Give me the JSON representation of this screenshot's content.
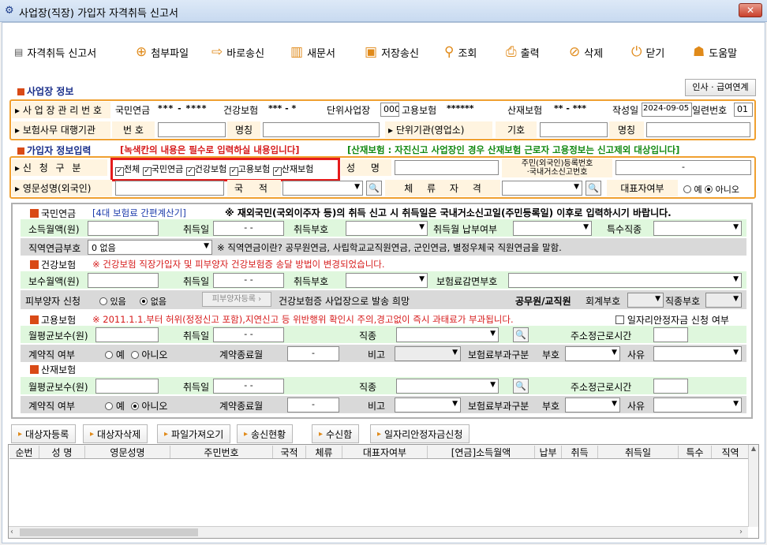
{
  "window": {
    "title": "사업장(직장) 가입자 자격취득 신고서",
    "close": "✕"
  },
  "toolbar": {
    "form_title": "자격취득 신고서",
    "attach": "첨부파일",
    "send_now": "바로송신",
    "new_doc": "새문서",
    "save_send": "저장송신",
    "query": "조회",
    "print": "출력",
    "delete": "삭제",
    "close": "닫기",
    "help": "도움말"
  },
  "workplace": {
    "section": "사업장 정보",
    "link_button": "인사 · 급여연계",
    "mgmt_no_label": "사 업 장 관 리 번 호",
    "pension_label": "국민연금",
    "pension_value": "*** - ****",
    "health_label": "건강보험",
    "health_value": "*** - *",
    "unit_label": "단위사업장",
    "unit_value": "000",
    "employ_label": "고용보험",
    "employ_value": "******",
    "industrial_label": "산재보험",
    "industrial_value": "** - ***",
    "written_label": "작성일",
    "written_value": "2024-09-05",
    "serial_label": "일련번호",
    "serial_value": "01",
    "agency_label": "보험사무 대행기관",
    "no_label": "번 호",
    "name_label": "명칭",
    "unit_org_label": "단위기관(영업소)",
    "code_label": "기호",
    "name2_label": "명칭"
  },
  "subscriber": {
    "section": "가입자 정보입력",
    "required_note": "[녹색칸의 내용은 필수로 입력하실 내용입니다]",
    "industrial_note": "[산재보험 : 자진신고 사업장인 경우 산재보험 근로자 고용정보는 신고제외 대상입니다]",
    "apply_label": "신 청 구 분",
    "apply_all": "전체",
    "apply_pension": "국민연금",
    "apply_health": "건강보험",
    "apply_employ": "고용보험",
    "apply_industrial": "산재보험",
    "name_label": "성 명",
    "resident_label_1": "주민(외국인)등록번호",
    "resident_label_2": "·국내거소신고번호",
    "resident_value": "-",
    "eng_name_label": "영문성명(외국인)",
    "nation_label": "국 적",
    "stay_label": "체 류 자 격",
    "rep_label": "대표자여부",
    "yes": "예",
    "no": "아니오"
  },
  "pension": {
    "title": "국민연금",
    "calc_link": "[4대 보험료 간편계산기]",
    "notice": "※ 재외국민(국외이주자 등)의 취득 신고 시 취득일은 국내거소신고일(주민등록일) 이후로 입력하시기 바랍니다.",
    "income_label": "소득월액(원)",
    "acq_date_label": "취득일",
    "acq_date_value": "- -",
    "acq_code_label": "취득부호",
    "pay_label": "취득월 납부여부",
    "special_label": "특수직종",
    "occ_pension_label": "직역연금부호",
    "occ_pension_value": "0    없음",
    "occ_note": "※ 직역연금이란? 공무원연금, 사립학교교직원연금, 군인연금, 별정우체국 직원연금을 말함."
  },
  "health": {
    "title": "건강보험",
    "notice": "※ 건강보험 직장가입자 및 피부양자 건강보험증 송달 방법이 변경되었습니다.",
    "pay_label": "보수월액(원)",
    "acq_date_label": "취득일",
    "acq_date_value": "- -",
    "acq_code_label": "취득부호",
    "reduce_label": "보험료감면부호",
    "dependent_label": "피부양자 신청",
    "has": "있음",
    "none": "없음",
    "dep_button": "피부양자등록 ›",
    "card_note": "건강보험증 사업장으로 발송 희망",
    "civil_label": "공무원/교직원",
    "account_label": "회계부호",
    "job_label": "직종부호"
  },
  "employ": {
    "title": "고용보험",
    "notice": "※ 2011.1.1.부터 허위(정정신고 포함),지연신고 등 위반행위 확인시 주의,경고없이 즉시 과태료가 부과됩니다.",
    "stability_label": "일자리안정자금 신청 여부",
    "avg_pay_label": "월평균보수(원)",
    "acq_date_label": "취득일",
    "acq_date_value": "- -",
    "job_label": "직종",
    "hours_label": "주소정근로시간",
    "contract_label": "계약직 여부",
    "yes": "예",
    "no": "아니오",
    "end_label": "계약종료월",
    "end_value": "-",
    "remark_label": "비고",
    "class_label": "보험료부과구분",
    "code_label": "부호",
    "reason_label": "사유"
  },
  "industrial": {
    "title": "산재보험",
    "avg_pay_label": "월평균보수(원)",
    "acq_date_label": "취득일",
    "acq_date_value": "- -",
    "job_label": "직종",
    "hours_label": "주소정근로시간",
    "contract_label": "계약직 여부",
    "yes": "예",
    "no": "아니오",
    "end_label": "계약종료월",
    "end_value": "-",
    "remark_label": "비고",
    "class_label": "보험료부과구분",
    "code_label": "부호",
    "reason_label": "사유"
  },
  "actions": {
    "register": "대상자등록",
    "delete": "대상자삭제",
    "import": "파일가져오기",
    "status": "송신현황",
    "receive": "수신함",
    "stability": "일자리안정자금신청"
  },
  "grid": {
    "columns": [
      "순번",
      "성 명",
      "영문성명",
      "주민번호",
      "국적",
      "체류",
      "대표자여부",
      "[연금]소득월액",
      "납부",
      "취득",
      "취득일",
      "특수",
      "직역"
    ]
  }
}
